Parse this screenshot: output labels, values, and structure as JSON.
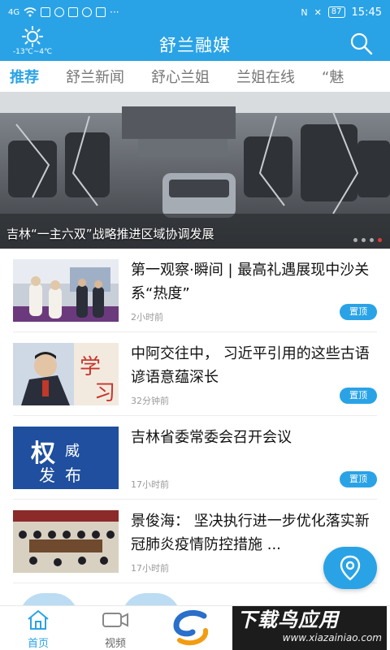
{
  "statusbar": {
    "signal": "4G",
    "time": "15:45",
    "battery": "87"
  },
  "header": {
    "title": "舒兰融媒",
    "weather_temp": "-13℃~4℃"
  },
  "tabs": [
    {
      "label": "推荐",
      "active": true
    },
    {
      "label": "舒兰新闻",
      "active": false
    },
    {
      "label": "舒心兰姐",
      "active": false
    },
    {
      "label": "兰姐在线",
      "active": false
    },
    {
      "label": "“魅",
      "active": false
    }
  ],
  "banner": {
    "caption": "吉林“一主六双”战略推进区域协调发展",
    "slides_total": 4,
    "active_slide": 4
  },
  "news": [
    {
      "title": "第一观察·瞬间 | 最高礼遇展现中沙关系“热度”",
      "time": "2小时前",
      "badge": "置顶"
    },
    {
      "title": "中阿交往中， 习近平引用的这些古语谚语意蕴深长",
      "time": "32分钟前",
      "badge": "置顶"
    },
    {
      "title": "吉林省委常委会召开会议",
      "time": "17小时前",
      "badge": "置顶",
      "thumb_text": [
        "权",
        "威",
        "发",
        "布"
      ]
    },
    {
      "title": "景俊海： 坚决执行进一步优化落实新冠肺炎疫情防控措施 ...",
      "time": "17小时前",
      "badge": ""
    }
  ],
  "bottomnav": {
    "home": "首页",
    "video": "视频"
  },
  "watermark": {
    "main": "下载鸟应用",
    "sub": "www.xiazainiao.com"
  },
  "colors": {
    "brand": "#2aa3e6",
    "active_dot": "#e23b3b"
  }
}
